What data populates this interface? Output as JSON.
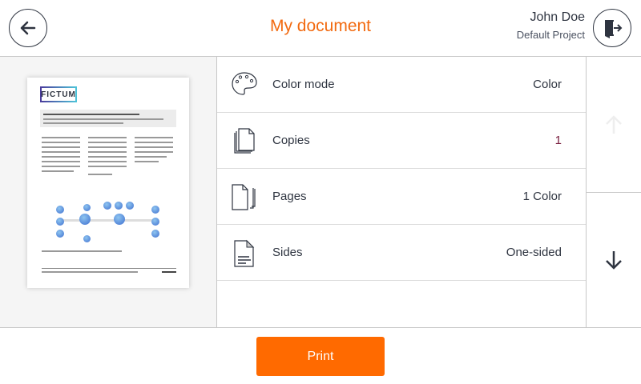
{
  "header": {
    "title": "My document",
    "user_name": "John Doe",
    "project": "Default Project",
    "back_icon": "arrow-left-icon",
    "logout_icon": "logout-door-icon"
  },
  "preview": {
    "logo_text": "FICTUM"
  },
  "options": [
    {
      "icon": "palette-icon",
      "label": "Color mode",
      "value": "Color"
    },
    {
      "icon": "copies-icon",
      "label": "Copies",
      "value": "1",
      "value_color": "#7a2040"
    },
    {
      "icon": "pages-icon",
      "label": "Pages",
      "value": "1 Color"
    },
    {
      "icon": "document-lines-icon",
      "label": "Sides",
      "value": "One-sided"
    }
  ],
  "scroll": {
    "up_enabled": false,
    "down_enabled": true
  },
  "footer": {
    "print_label": "Print"
  },
  "colors": {
    "accent": "#ff6a00",
    "title": "#f26a10",
    "text": "#2e3440"
  }
}
